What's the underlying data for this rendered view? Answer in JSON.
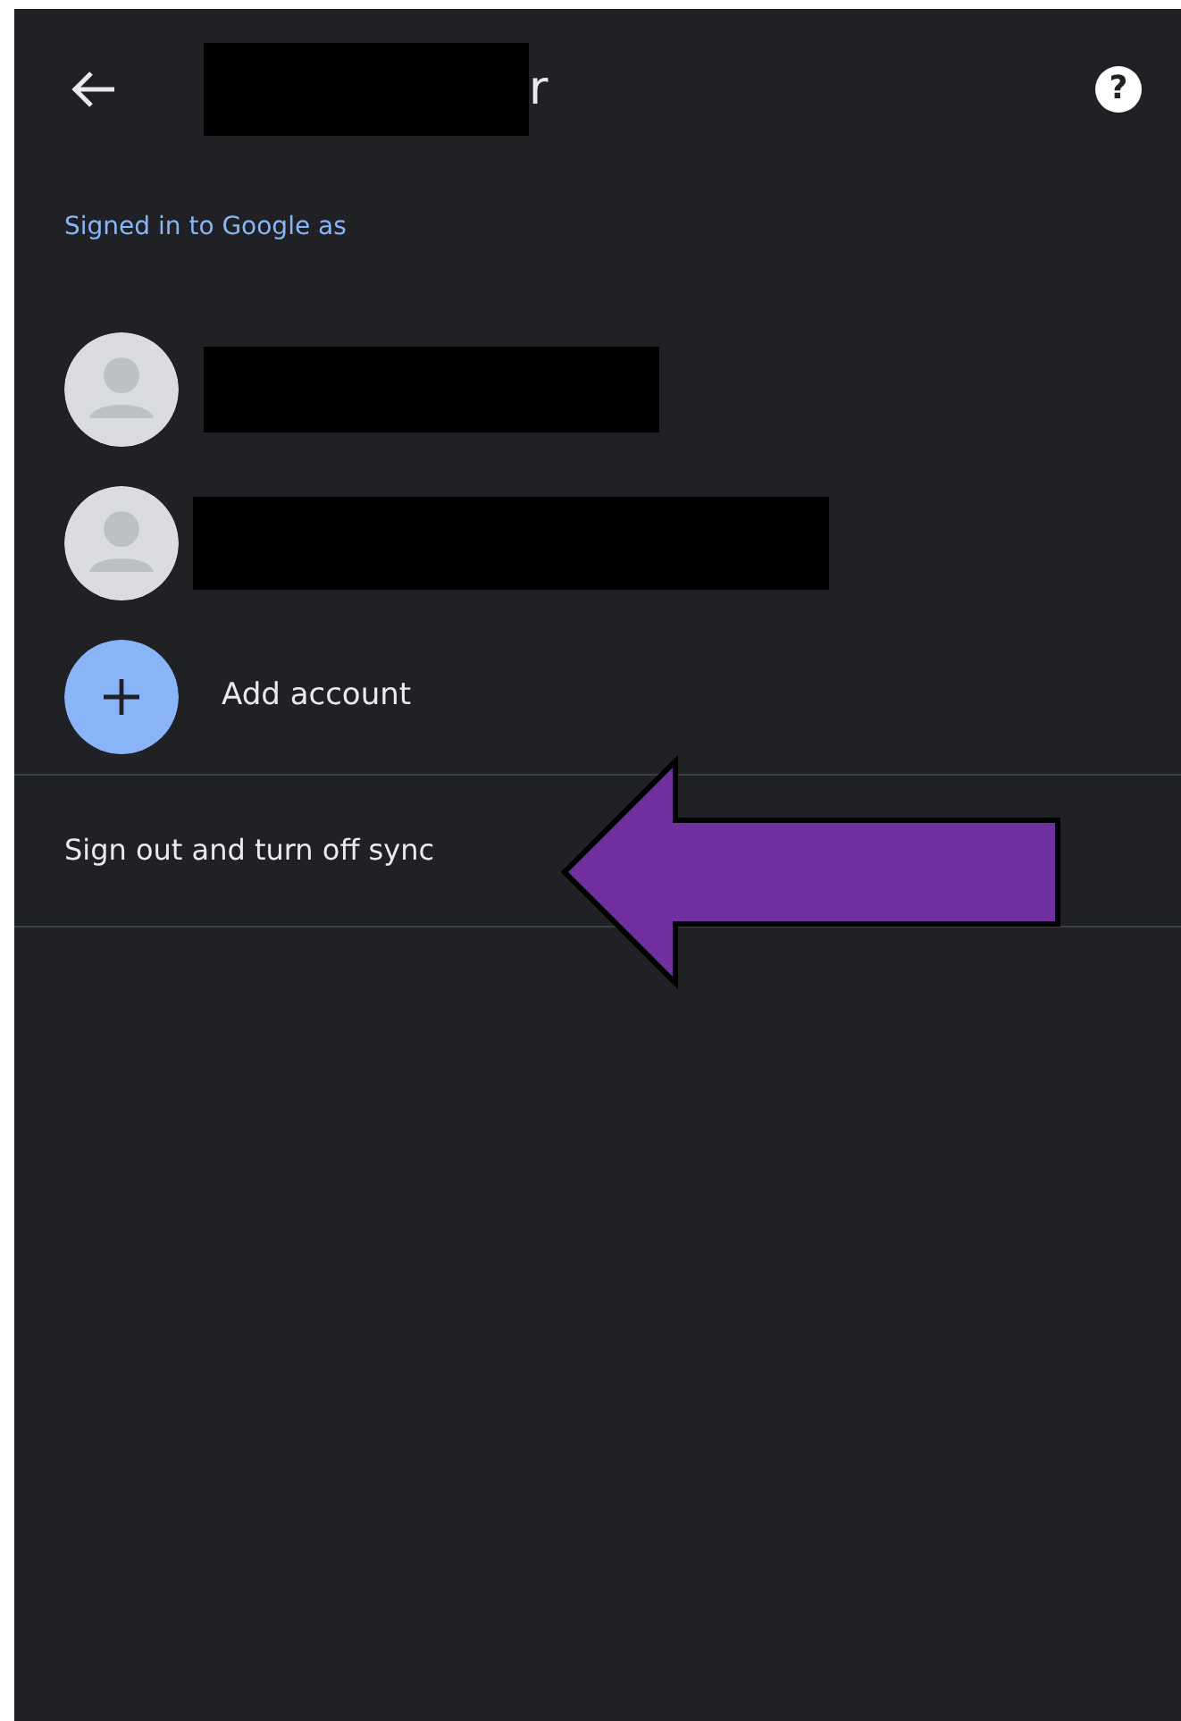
{
  "header": {
    "title": "r",
    "title_redacted": true,
    "help_glyph": "?"
  },
  "section_label": "Signed in to Google as",
  "accounts": [
    {
      "name_redacted": true
    },
    {
      "name_redacted": true
    }
  ],
  "add_account": {
    "label": "Add account"
  },
  "sign_out": {
    "label": "Sign out and turn off sync"
  },
  "annotation": {
    "kind": "arrow",
    "color": "#7030a0"
  }
}
